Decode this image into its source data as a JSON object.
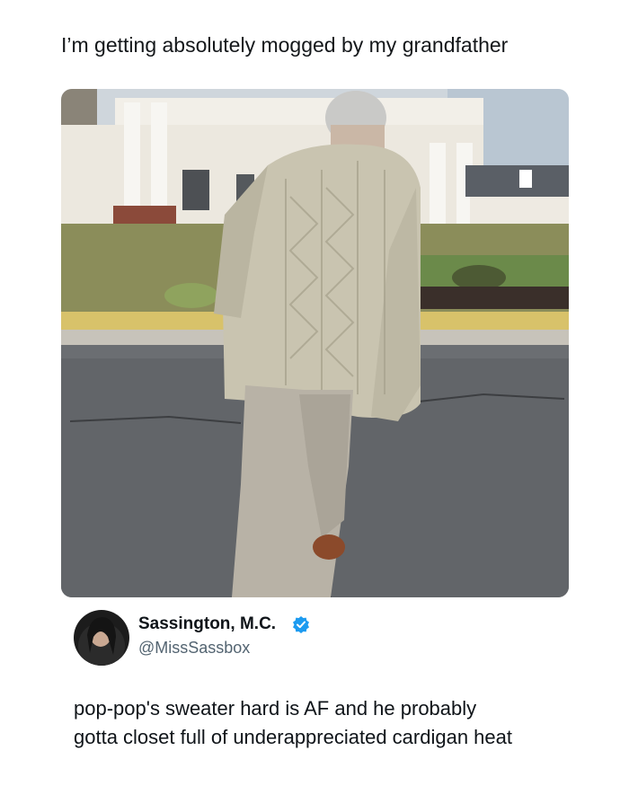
{
  "headline": "I’m getting absolutely mogged by my grandfather",
  "photo": {
    "description_icon": "photo-image"
  },
  "author": {
    "display_name": "Sassington, M.C.",
    "handle": "@MissSassbox",
    "verified_icon": "verified-badge-icon",
    "verified_color": "#1d9bf0"
  },
  "tweet": {
    "line1": "pop-pop's sweater hard is AF and he probably",
    "line2": "gotta closet full of underappreciated cardigan heat"
  }
}
